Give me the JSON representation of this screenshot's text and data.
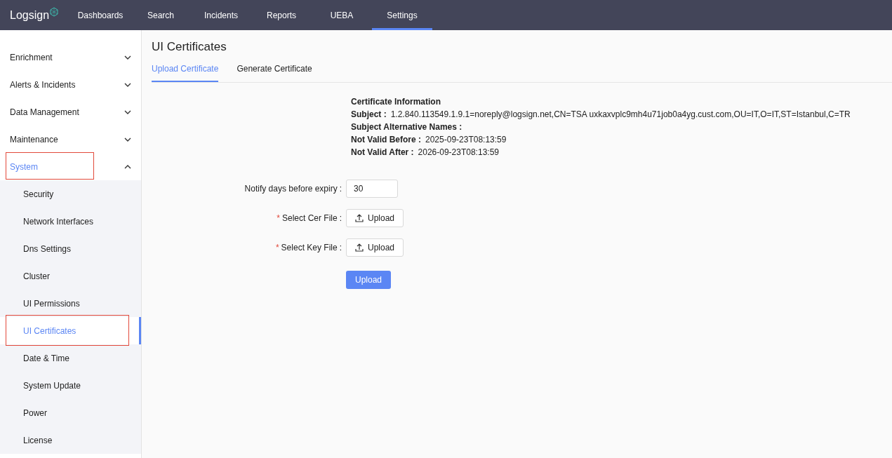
{
  "header": {
    "logo": "Logsign",
    "nav": [
      {
        "label": "Dashboards",
        "selected": false
      },
      {
        "label": "Search",
        "selected": false
      },
      {
        "label": "Incidents",
        "selected": false
      },
      {
        "label": "Reports",
        "selected": false
      },
      {
        "label": "UEBA",
        "selected": false
      },
      {
        "label": "Settings",
        "selected": true
      }
    ]
  },
  "sidebar": {
    "items": [
      {
        "label": "Enrichment",
        "expanded": false,
        "selected": false,
        "highlighted": false
      },
      {
        "label": "Alerts & Incidents",
        "expanded": false,
        "selected": false,
        "highlighted": false
      },
      {
        "label": "Data Management",
        "expanded": false,
        "selected": false,
        "highlighted": false
      },
      {
        "label": "Maintenance",
        "expanded": false,
        "selected": false,
        "highlighted": false
      },
      {
        "label": "System",
        "expanded": true,
        "selected": true,
        "highlighted": true,
        "children": [
          {
            "label": "Security",
            "selected": false,
            "highlighted": false
          },
          {
            "label": "Network Interfaces",
            "selected": false,
            "highlighted": false
          },
          {
            "label": "Dns Settings",
            "selected": false,
            "highlighted": false
          },
          {
            "label": "Cluster",
            "selected": false,
            "highlighted": false
          },
          {
            "label": "UI Permissions",
            "selected": false,
            "highlighted": false
          },
          {
            "label": "UI Certificates",
            "selected": true,
            "highlighted": true
          },
          {
            "label": "Date & Time",
            "selected": false,
            "highlighted": false
          },
          {
            "label": "System Update",
            "selected": false,
            "highlighted": false
          },
          {
            "label": "Power",
            "selected": false,
            "highlighted": false
          },
          {
            "label": "License",
            "selected": false,
            "highlighted": false
          }
        ]
      }
    ]
  },
  "page": {
    "title": "UI Certificates",
    "tabs": [
      {
        "label": "Upload Certificate",
        "selected": true
      },
      {
        "label": "Generate Certificate",
        "selected": false
      }
    ],
    "certificate": {
      "heading": "Certificate Information",
      "fields": [
        {
          "label": "Subject :",
          "value": "1.2.840.113549.1.9.1=noreply@logsign.net,CN=TSA uxkaxvplc9mh4u71job0a4yg.cust.com,OU=IT,O=IT,ST=Istanbul,C=TR"
        },
        {
          "label": "Subject Alternative Names :"
        },
        {
          "label": "Not Valid Before :",
          "value": "2025-09-23T08:13:59"
        },
        {
          "label": "Not Valid After :",
          "value": "2026-09-23T08:13:59"
        }
      ]
    },
    "form": [
      {
        "kind": "input",
        "label": "Notify days before expiry",
        "colon": ":",
        "value": "30"
      },
      {
        "kind": "upload",
        "required_mark": "*",
        "label": "Select Cer File",
        "colon": ":",
        "button": "Upload"
      },
      {
        "kind": "upload",
        "required_mark": "*",
        "label": "Select Key File",
        "colon": ":",
        "button": "Upload"
      }
    ],
    "submit": "Upload"
  }
}
